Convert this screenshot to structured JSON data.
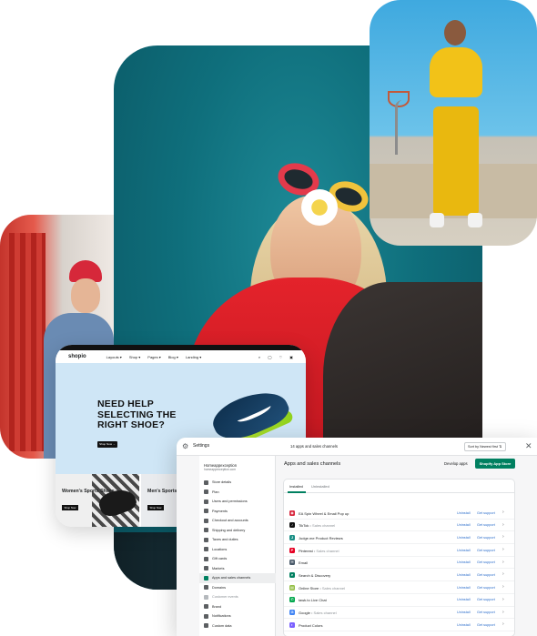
{
  "shopio": {
    "announcement": "",
    "logo": "shopio",
    "nav": [
      "Layouts ▾",
      "Shop ▾",
      "Pages ▾",
      "Blog ▾",
      "Landing ▾"
    ],
    "eyebrow": "",
    "headline": "NEED HELP SELECTING THE RIGHT SHOE?",
    "shop_button": "Shop Now →",
    "cards": [
      {
        "title": "Women's Sports Shoes",
        "button": "Shop Now"
      },
      {
        "title": "Men's Sports Shoes",
        "button": "Shop Now"
      }
    ]
  },
  "admin": {
    "topbar": {
      "title": "Settings",
      "count": "14 apps and sales channels",
      "sort": "Sort by Newest first ⇅",
      "close": "✕"
    },
    "sidebar": {
      "store_name": "Homeappexception",
      "store_url": "homeappexception.com",
      "items": [
        {
          "label": "Store details",
          "state": "normal"
        },
        {
          "label": "Plan",
          "state": "normal"
        },
        {
          "label": "Users and permissions",
          "state": "normal"
        },
        {
          "label": "Payments",
          "state": "normal"
        },
        {
          "label": "Checkout and accounts",
          "state": "normal"
        },
        {
          "label": "Shipping and delivery",
          "state": "normal"
        },
        {
          "label": "Taxes and duties",
          "state": "normal"
        },
        {
          "label": "Locations",
          "state": "normal"
        },
        {
          "label": "Gift cards",
          "state": "normal"
        },
        {
          "label": "Markets",
          "state": "normal"
        },
        {
          "label": "Apps and sales channels",
          "state": "active"
        },
        {
          "label": "Domains",
          "state": "normal"
        },
        {
          "label": "Customer events",
          "state": "disabled"
        },
        {
          "label": "Brand",
          "state": "normal"
        },
        {
          "label": "Notifications",
          "state": "normal"
        },
        {
          "label": "Custom data",
          "state": "normal"
        }
      ]
    },
    "content": {
      "title": "Apps and sales channels",
      "develop_apps": "Develop apps",
      "app_store_button": "Shopify App Store",
      "tabs": [
        "Installed",
        "Uninstalled"
      ],
      "uninstall_label": "Uninstall",
      "support_label": "Get support",
      "apps": [
        {
          "name": "EA Spin Wheel & Email Pop up",
          "channel": "",
          "color": "#d7263d",
          "glyph": "◉",
          "uninstall": true
        },
        {
          "name": "TikTok",
          "channel": " • Sales channel",
          "color": "#111111",
          "glyph": "♪",
          "uninstall": true
        },
        {
          "name": "Judge.me Product Reviews",
          "channel": "",
          "color": "#1b8f86",
          "glyph": "J",
          "uninstall": true
        },
        {
          "name": "Pinterest",
          "channel": " • Sales channel",
          "color": "#e60023",
          "glyph": "P",
          "uninstall": true
        },
        {
          "name": "Email",
          "channel": "",
          "color": "#4a5a6a",
          "glyph": "✉",
          "uninstall": true
        },
        {
          "name": "Search & Discovery",
          "channel": "",
          "color": "#008060",
          "glyph": "⌕",
          "uninstall": true
        },
        {
          "name": "Online Store",
          "channel": " • Sales channel",
          "color": "#95bf47",
          "glyph": "▤",
          "uninstall": true
        },
        {
          "name": "tawk.to Live Chat",
          "channel": "",
          "color": "#03a84e",
          "glyph": "✆",
          "uninstall": true
        },
        {
          "name": "Google",
          "channel": " • Sales channel",
          "color": "#4285f4",
          "glyph": "G",
          "uninstall": true
        },
        {
          "name": "Product Colors",
          "channel": "",
          "color": "#7b61ff",
          "glyph": "◐",
          "uninstall": true
        }
      ]
    }
  }
}
